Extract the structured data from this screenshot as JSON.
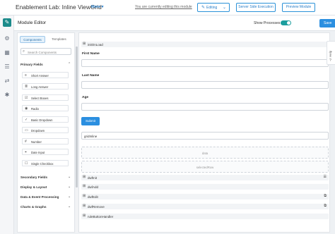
{
  "topbar": {
    "title": "Enablement Lab: Inline ViewGrid",
    "more": "More ▾",
    "editing_note": "You are currently editing this module",
    "editing_button": "Editing",
    "sse_button": "Server Side Execution",
    "preview_button": "Preview Module"
  },
  "leftnav": {
    "icons": [
      "gear-icon",
      "grid-icon",
      "layers-icon",
      "arrows-icon",
      "wrench-icon"
    ]
  },
  "editor": {
    "title": "Module Editor",
    "show_processes_label": "Show Processes",
    "show_processes_on": true,
    "save_label": "Save"
  },
  "panel": {
    "tab_components": "Components",
    "tab_templates": "Templates",
    "search_placeholder": "Search Components",
    "primary_title": "Primary Fields",
    "primary_items": [
      {
        "icon": "≡",
        "label": "Short Answer"
      },
      {
        "icon": "≣",
        "label": "Long Answer"
      },
      {
        "icon": "☑",
        "label": "Select Boxes"
      },
      {
        "icon": "◉",
        "label": "Radio"
      },
      {
        "icon": "✓",
        "label": "Basic Dropdown"
      },
      {
        "icon": "▭",
        "label": "Dropdown"
      },
      {
        "icon": "#",
        "label": "Number"
      },
      {
        "icon": "⌖",
        "label": "Date Input"
      },
      {
        "icon": "☐",
        "label": "Single Checkbox"
      }
    ],
    "secondary_title": "Secondary Fields",
    "display_title": "Display & Layout",
    "data_title": "Data & Event Processing",
    "charts_title": "Charts & Graphs"
  },
  "canvas": {
    "on_load": "initOnLoad",
    "first_name_label": "First Name",
    "last_name_label": "Last Name",
    "age_label": "Age",
    "submit_label": "Submit",
    "grid_inline": "gridInline",
    "dropzone_data": "data",
    "dropzone_selected": "selectedRow",
    "processes": [
      "dwfInit",
      "dwfAdd",
      "dwfEdit",
      "dwfRemove",
      "ruleButtonHandler"
    ]
  },
  "help": {
    "label": "Help"
  },
  "colors": {
    "accent": "#2b8fe0",
    "brand": "#1b8a8a",
    "toggle_on": "#1b9e9e"
  }
}
